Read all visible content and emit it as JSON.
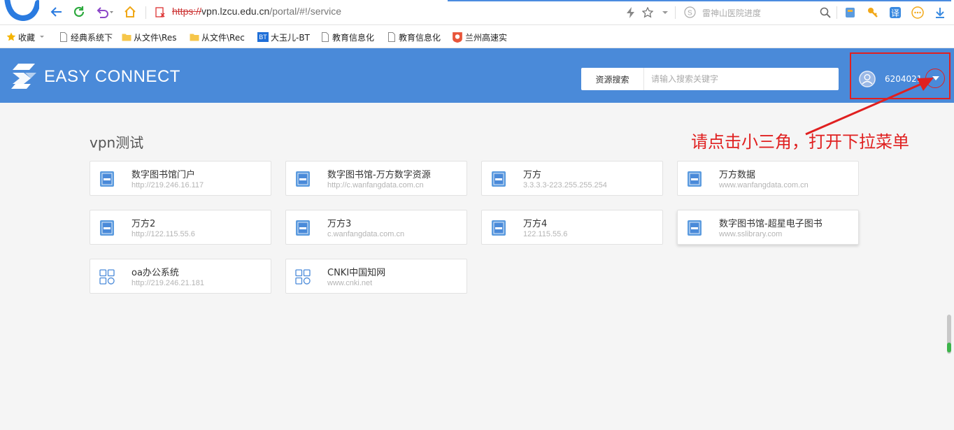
{
  "browser": {
    "url_scheme": "https://",
    "url_host": "vpn.lzcu.edu.cn",
    "url_path": "/portal/#!/service",
    "search_hint": "雷神山医院进度",
    "bookmarks": [
      {
        "label": "收藏",
        "icon": "star-icon"
      },
      {
        "label": "经典系统下",
        "icon": "page-icon"
      },
      {
        "label": "从文件\\Res",
        "icon": "folder-icon"
      },
      {
        "label": "从文件\\Rec",
        "icon": "folder-icon"
      },
      {
        "label": "大玉儿-BT",
        "icon": "bt-icon"
      },
      {
        "label": "教育信息化",
        "icon": "page-icon"
      },
      {
        "label": "教育信息化",
        "icon": "page-icon"
      },
      {
        "label": "兰州高速实",
        "icon": "red-badge-icon"
      }
    ],
    "bt_badge": "BT"
  },
  "header": {
    "logo_text": "EASY CONNECT",
    "search_category": "资源搜索",
    "search_placeholder": "请输入搜索关键字",
    "user_name": "6204021..."
  },
  "annotation": {
    "text": "请点击小三角，打开下拉菜单"
  },
  "main": {
    "section_title": "vpn测试",
    "resources": [
      {
        "title": "数字图书馆门户",
        "url": "http://219.246.16.117",
        "icon": "book-icon"
      },
      {
        "title": "数字图书馆-万方数字资源",
        "url": "http://c.wanfangdata.com.cn",
        "icon": "book-icon"
      },
      {
        "title": "万方",
        "url": "3.3.3.3-223.255.255.254",
        "icon": "book-icon"
      },
      {
        "title": "万方数据",
        "url": "www.wanfangdata.com.cn",
        "icon": "book-icon"
      },
      {
        "title": "万方2",
        "url": "http://122.115.55.6",
        "icon": "book-icon"
      },
      {
        "title": "万方3",
        "url": "c.wanfangdata.com.cn",
        "icon": "book-icon"
      },
      {
        "title": "万方4",
        "url": "122.115.55.6",
        "icon": "book-icon"
      },
      {
        "title": "数字图书馆-超星电子图书",
        "url": "www.sslibrary.com",
        "icon": "book-icon"
      },
      {
        "title": "oa办公系统",
        "url": "http://219.246.21.181",
        "icon": "grid-icon"
      },
      {
        "title": "CNKI中国知网",
        "url": "www.cnki.net",
        "icon": "grid-icon"
      }
    ]
  },
  "colors": {
    "header_bg": "#4a8ad9",
    "annotation": "#e02020",
    "page_bg": "#f5f5f5"
  }
}
